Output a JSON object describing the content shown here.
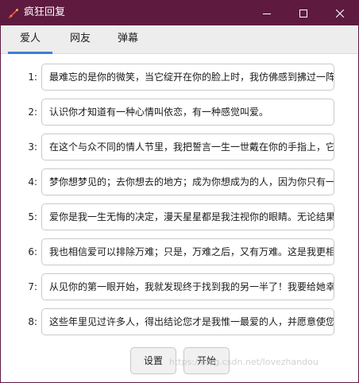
{
  "window": {
    "title": "疯狂回复",
    "titlebar_color": "#5e1a3f",
    "controls": {
      "minimize_icon": "minimize-icon",
      "maximize_icon": "maximize-icon",
      "close_icon": "close-icon"
    }
  },
  "tabs": [
    {
      "label": "爱人",
      "active": true
    },
    {
      "label": "网友",
      "active": false
    },
    {
      "label": "弹幕",
      "active": false
    }
  ],
  "accent_color": "#3d7fd0",
  "rows": [
    {
      "num": "1:",
      "value": "最难忘的是你的微笑，当它绽开在你的脸上时，我仿佛感到拂过一阵春风"
    },
    {
      "num": "2:",
      "value": "认识你才知道有一种心情叫依恋，有一种感觉叫爱。"
    },
    {
      "num": "3:",
      "value": "在这个与众不同的情人节里，我把誓言一生一世戴在你的手指上，它会让你"
    },
    {
      "num": "4:",
      "value": "梦你想梦见的；去你想去的地方；成为你想成为的人，因为你只有一次生命"
    },
    {
      "num": "5:",
      "value": "爱你是我一生无悔的决定，漫天星星都是我注视你的眼睛。无论结果怎样"
    },
    {
      "num": "6:",
      "value": "我也相信爱可以排除万难；只是，万难之后，又有万难。这是我更相信的"
    },
    {
      "num": "7:",
      "value": "从见你的第一眼开始，我就发现终于找到我的另一半了！我要给她幸福"
    },
    {
      "num": "8:",
      "value": "这些年里见过许多人，得出结论您才是我惟一最爱的人，并愿意使您幸福"
    }
  ],
  "buttons": {
    "settings": "设置",
    "start": "开始"
  },
  "watermark": "https://blog.csdn.net/lovezhandou"
}
